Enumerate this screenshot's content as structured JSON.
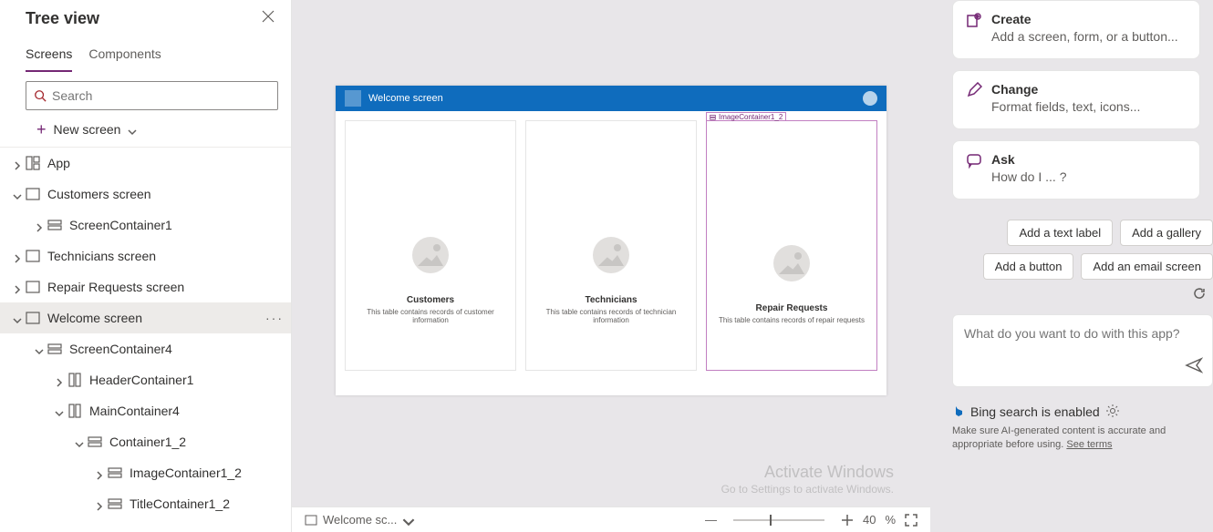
{
  "treeview": {
    "title": "Tree view",
    "tabs": {
      "screens": "Screens",
      "components": "Components"
    },
    "search_placeholder": "Search",
    "new_screen": "New screen",
    "nodes": {
      "app": "App",
      "customers": "Customers screen",
      "sc1": "ScreenContainer1",
      "tech": "Technicians screen",
      "repair": "Repair Requests screen",
      "welcome": "Welcome screen",
      "sc4": "ScreenContainer4",
      "hdr1": "HeaderContainer1",
      "main4": "MainContainer4",
      "cont12": "Container1_2",
      "imgc12": "ImageContainer1_2",
      "titlec12": "TitleContainer1_2"
    }
  },
  "preview": {
    "appbar_title": "Welcome screen",
    "selected_label": "ImageContainer1_2",
    "cards": [
      {
        "title": "Customers",
        "desc": "This table contains records of customer information"
      },
      {
        "title": "Technicians",
        "desc": "This table contains records of technician information"
      },
      {
        "title": "Repair Requests",
        "desc": "This table contains records of repair requests"
      }
    ]
  },
  "statusbar": {
    "screen": "Welcome sc...",
    "zoom": "40",
    "zoom_unit": "%"
  },
  "copilot": {
    "cards": [
      {
        "title": "Create",
        "desc": "Add a screen, form, or a button..."
      },
      {
        "title": "Change",
        "desc": "Format fields, text, icons..."
      },
      {
        "title": "Ask",
        "desc": "How do I ... ?"
      }
    ],
    "suggestions": {
      "textlabel": "Add a text label",
      "gallery": "Add a gallery",
      "button": "Add a button",
      "emailscreen": "Add an email screen"
    },
    "ask_placeholder": "What do you want to do with this app?",
    "bing": "Bing search is enabled",
    "disclaimer_pre": "Make sure AI-generated content is accurate and appropriate before using. ",
    "disclaimer_link": "See terms"
  },
  "watermark": {
    "l1": "Activate Windows",
    "l2": "Go to Settings to activate Windows."
  }
}
